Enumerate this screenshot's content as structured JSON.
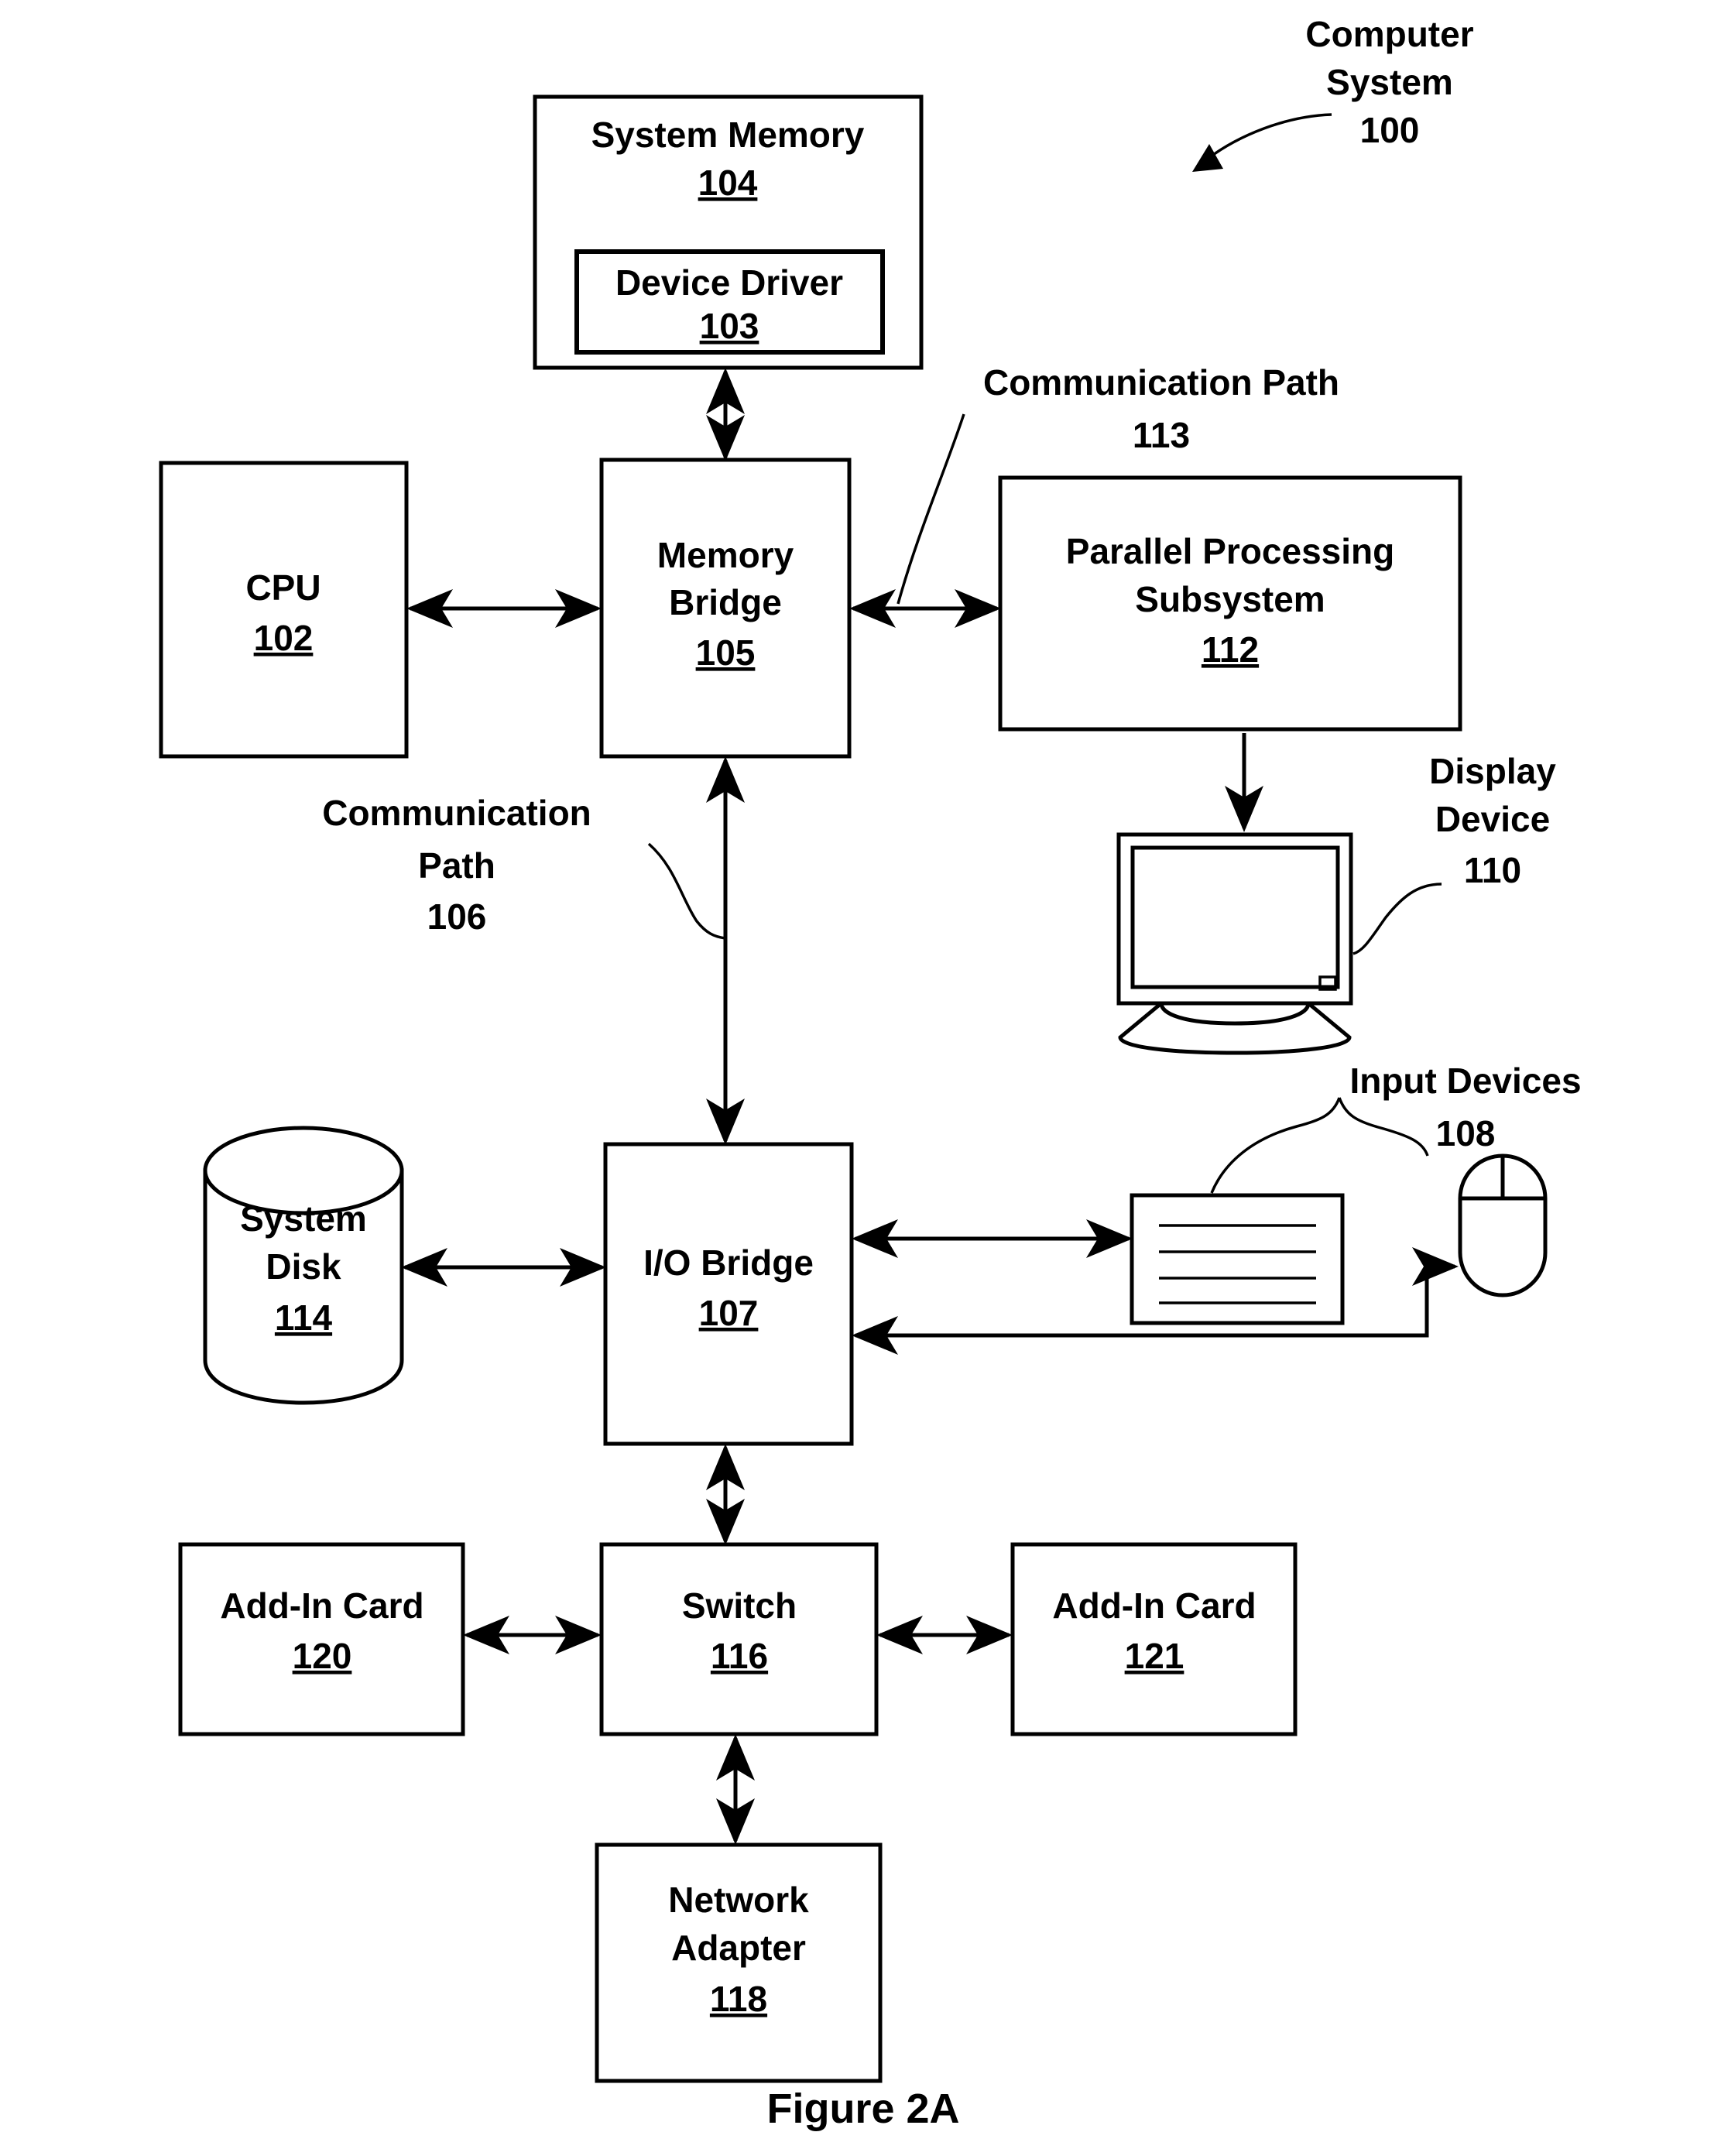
{
  "figure": {
    "caption": "Figure 2A",
    "system_callout": {
      "line1": "Computer",
      "line2": "System",
      "ref": "100"
    }
  },
  "blocks": {
    "system_memory": {
      "label": "System Memory",
      "ref": "104"
    },
    "device_driver": {
      "label": "Device Driver",
      "ref": "103"
    },
    "cpu": {
      "label": "CPU",
      "ref": "102"
    },
    "memory_bridge": {
      "label_line1": "Memory",
      "label_line2": "Bridge",
      "ref": "105"
    },
    "parallel_processing_subsystem": {
      "label_line1": "Parallel Processing",
      "label_line2": "Subsystem",
      "ref": "112"
    },
    "io_bridge": {
      "label": "I/O Bridge",
      "ref": "107"
    },
    "system_disk": {
      "label_line1": "System",
      "label_line2": "Disk",
      "ref": "114"
    },
    "switch": {
      "label": "Switch",
      "ref": "116"
    },
    "add_in_card_120": {
      "label": "Add-In Card",
      "ref": "120"
    },
    "add_in_card_121": {
      "label": "Add-In Card",
      "ref": "121"
    },
    "network_adapter": {
      "label_line1": "Network",
      "label_line2": "Adapter",
      "ref": "118"
    }
  },
  "callouts": {
    "communication_path_113": {
      "line1": "Communication Path",
      "ref": "113"
    },
    "communication_path_106": {
      "line1": "Communication",
      "line2": "Path",
      "ref": "106"
    },
    "display_device": {
      "line1": "Display",
      "line2": "Device",
      "ref": "110"
    },
    "input_devices": {
      "line1": "Input Devices",
      "ref": "108"
    }
  },
  "icons": {
    "display": "monitor-icon",
    "keyboard": "keyboard-icon",
    "mouse": "mouse-icon",
    "disk": "cylinder-disk-icon"
  },
  "colors": {
    "ink": "#000000",
    "paper": "#ffffff"
  }
}
